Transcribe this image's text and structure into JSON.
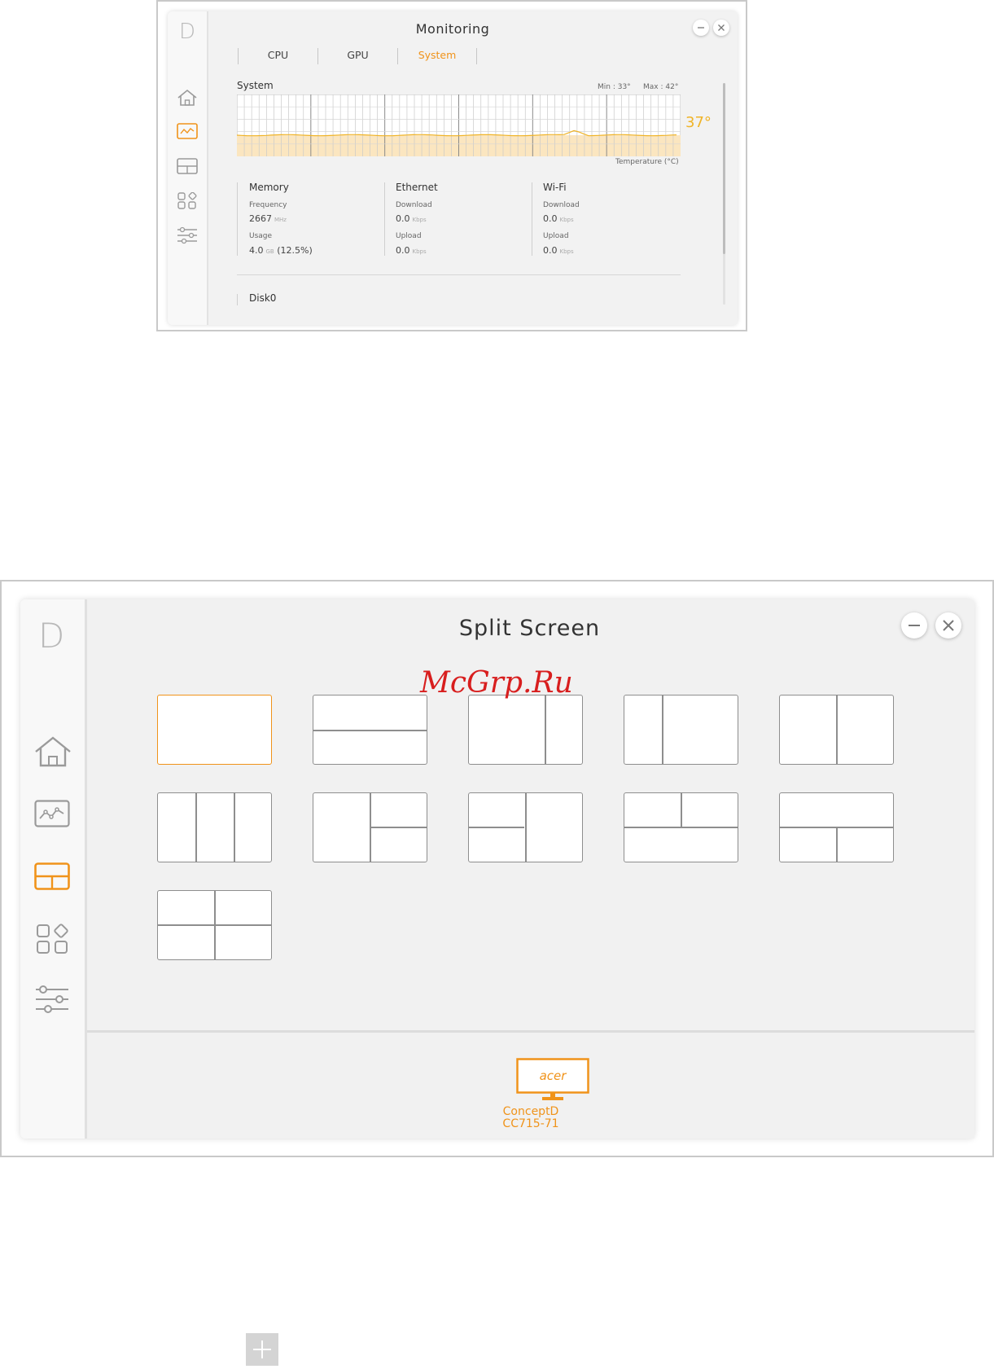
{
  "monitoring": {
    "logo": "D",
    "title": "Monitoring",
    "tabs": [
      {
        "label": "CPU",
        "active": false
      },
      {
        "label": "GPU",
        "active": false
      },
      {
        "label": "System",
        "active": true
      }
    ],
    "system": {
      "label": "System",
      "min_label": "Min : 33°",
      "max_label": "Max : 42°",
      "current_temp": "37°",
      "axis_label": "Temperature (°C)"
    },
    "memory": {
      "title": "Memory",
      "frequency_label": "Frequency",
      "frequency_value": "2667",
      "frequency_unit": "MHz",
      "usage_label": "Usage",
      "usage_value": "4.0",
      "usage_unit": "GB",
      "usage_percent": "(12.5%)"
    },
    "ethernet": {
      "title": "Ethernet",
      "download_label": "Download",
      "download_value": "0.0",
      "download_unit": "Kbps",
      "upload_label": "Upload",
      "upload_value": "0.0",
      "upload_unit": "Kbps"
    },
    "wifi": {
      "title": "Wi-Fi",
      "download_label": "Download",
      "download_value": "0.0",
      "download_unit": "Kbps",
      "upload_label": "Upload",
      "upload_value": "0.0",
      "upload_unit": "Kbps"
    },
    "disk": {
      "label": "Disk0"
    }
  },
  "split": {
    "logo": "D",
    "title": "Split Screen",
    "watermark": "McGrp.Ru",
    "monitor": {
      "brand": "acer",
      "name_line1": "ConceptD",
      "name_line2": "CC715-71"
    }
  },
  "colors": {
    "accent": "#f0931a",
    "text": "#333333",
    "background": "#f1f1f1",
    "watermark": "#d81e1e"
  },
  "icons": [
    "home-icon",
    "monitoring-icon",
    "split-screen-icon",
    "apps-icon",
    "settings-icon",
    "minimize-icon",
    "close-icon",
    "plus-icon"
  ]
}
